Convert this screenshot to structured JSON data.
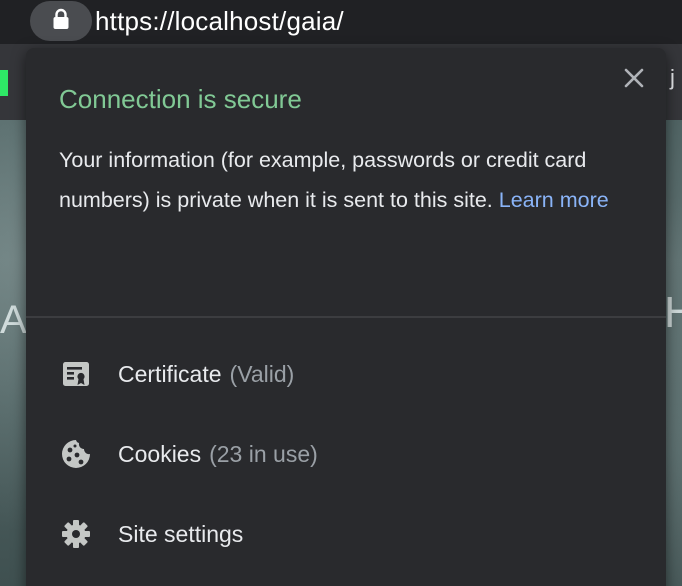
{
  "omnibox": {
    "url": "https://localhost/gaia/",
    "lock_icon": "lock-icon"
  },
  "background": {
    "right_edge_letter": "j",
    "left_glyph": "A",
    "right_glyph": "H"
  },
  "bubble": {
    "title": "Connection is secure",
    "title_color": "#81c995",
    "description": "Your information (for example, passwords or credit card numbers) is private when it is sent to this site.",
    "learn_more": "Learn more",
    "link_color": "#8ab4f8",
    "close_icon": "close-icon",
    "items": [
      {
        "icon": "certificate-icon",
        "label": "Certificate",
        "detail": "(Valid)"
      },
      {
        "icon": "cookie-icon",
        "label": "Cookies",
        "detail": "(23 in use)"
      },
      {
        "icon": "gear-icon",
        "label": "Site settings",
        "detail": ""
      }
    ]
  }
}
